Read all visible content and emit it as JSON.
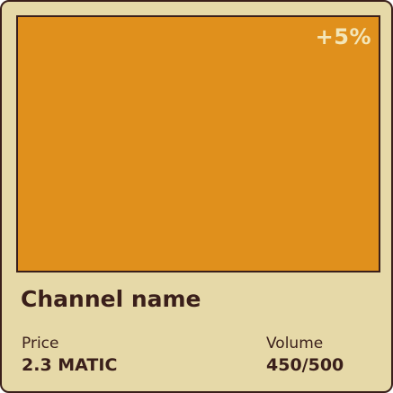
{
  "card": {
    "channel_name": "Channel name",
    "change_badge": "+5%",
    "price": {
      "label": "Price",
      "value": "2.3 MATIC"
    },
    "volume": {
      "label": "Volume",
      "value": "450/500"
    }
  },
  "colors": {
    "card_background": "#e6d9a8",
    "thumbnail": "#e0901c",
    "text": "#3a1f1a",
    "badge_text": "#f3e6b8"
  }
}
